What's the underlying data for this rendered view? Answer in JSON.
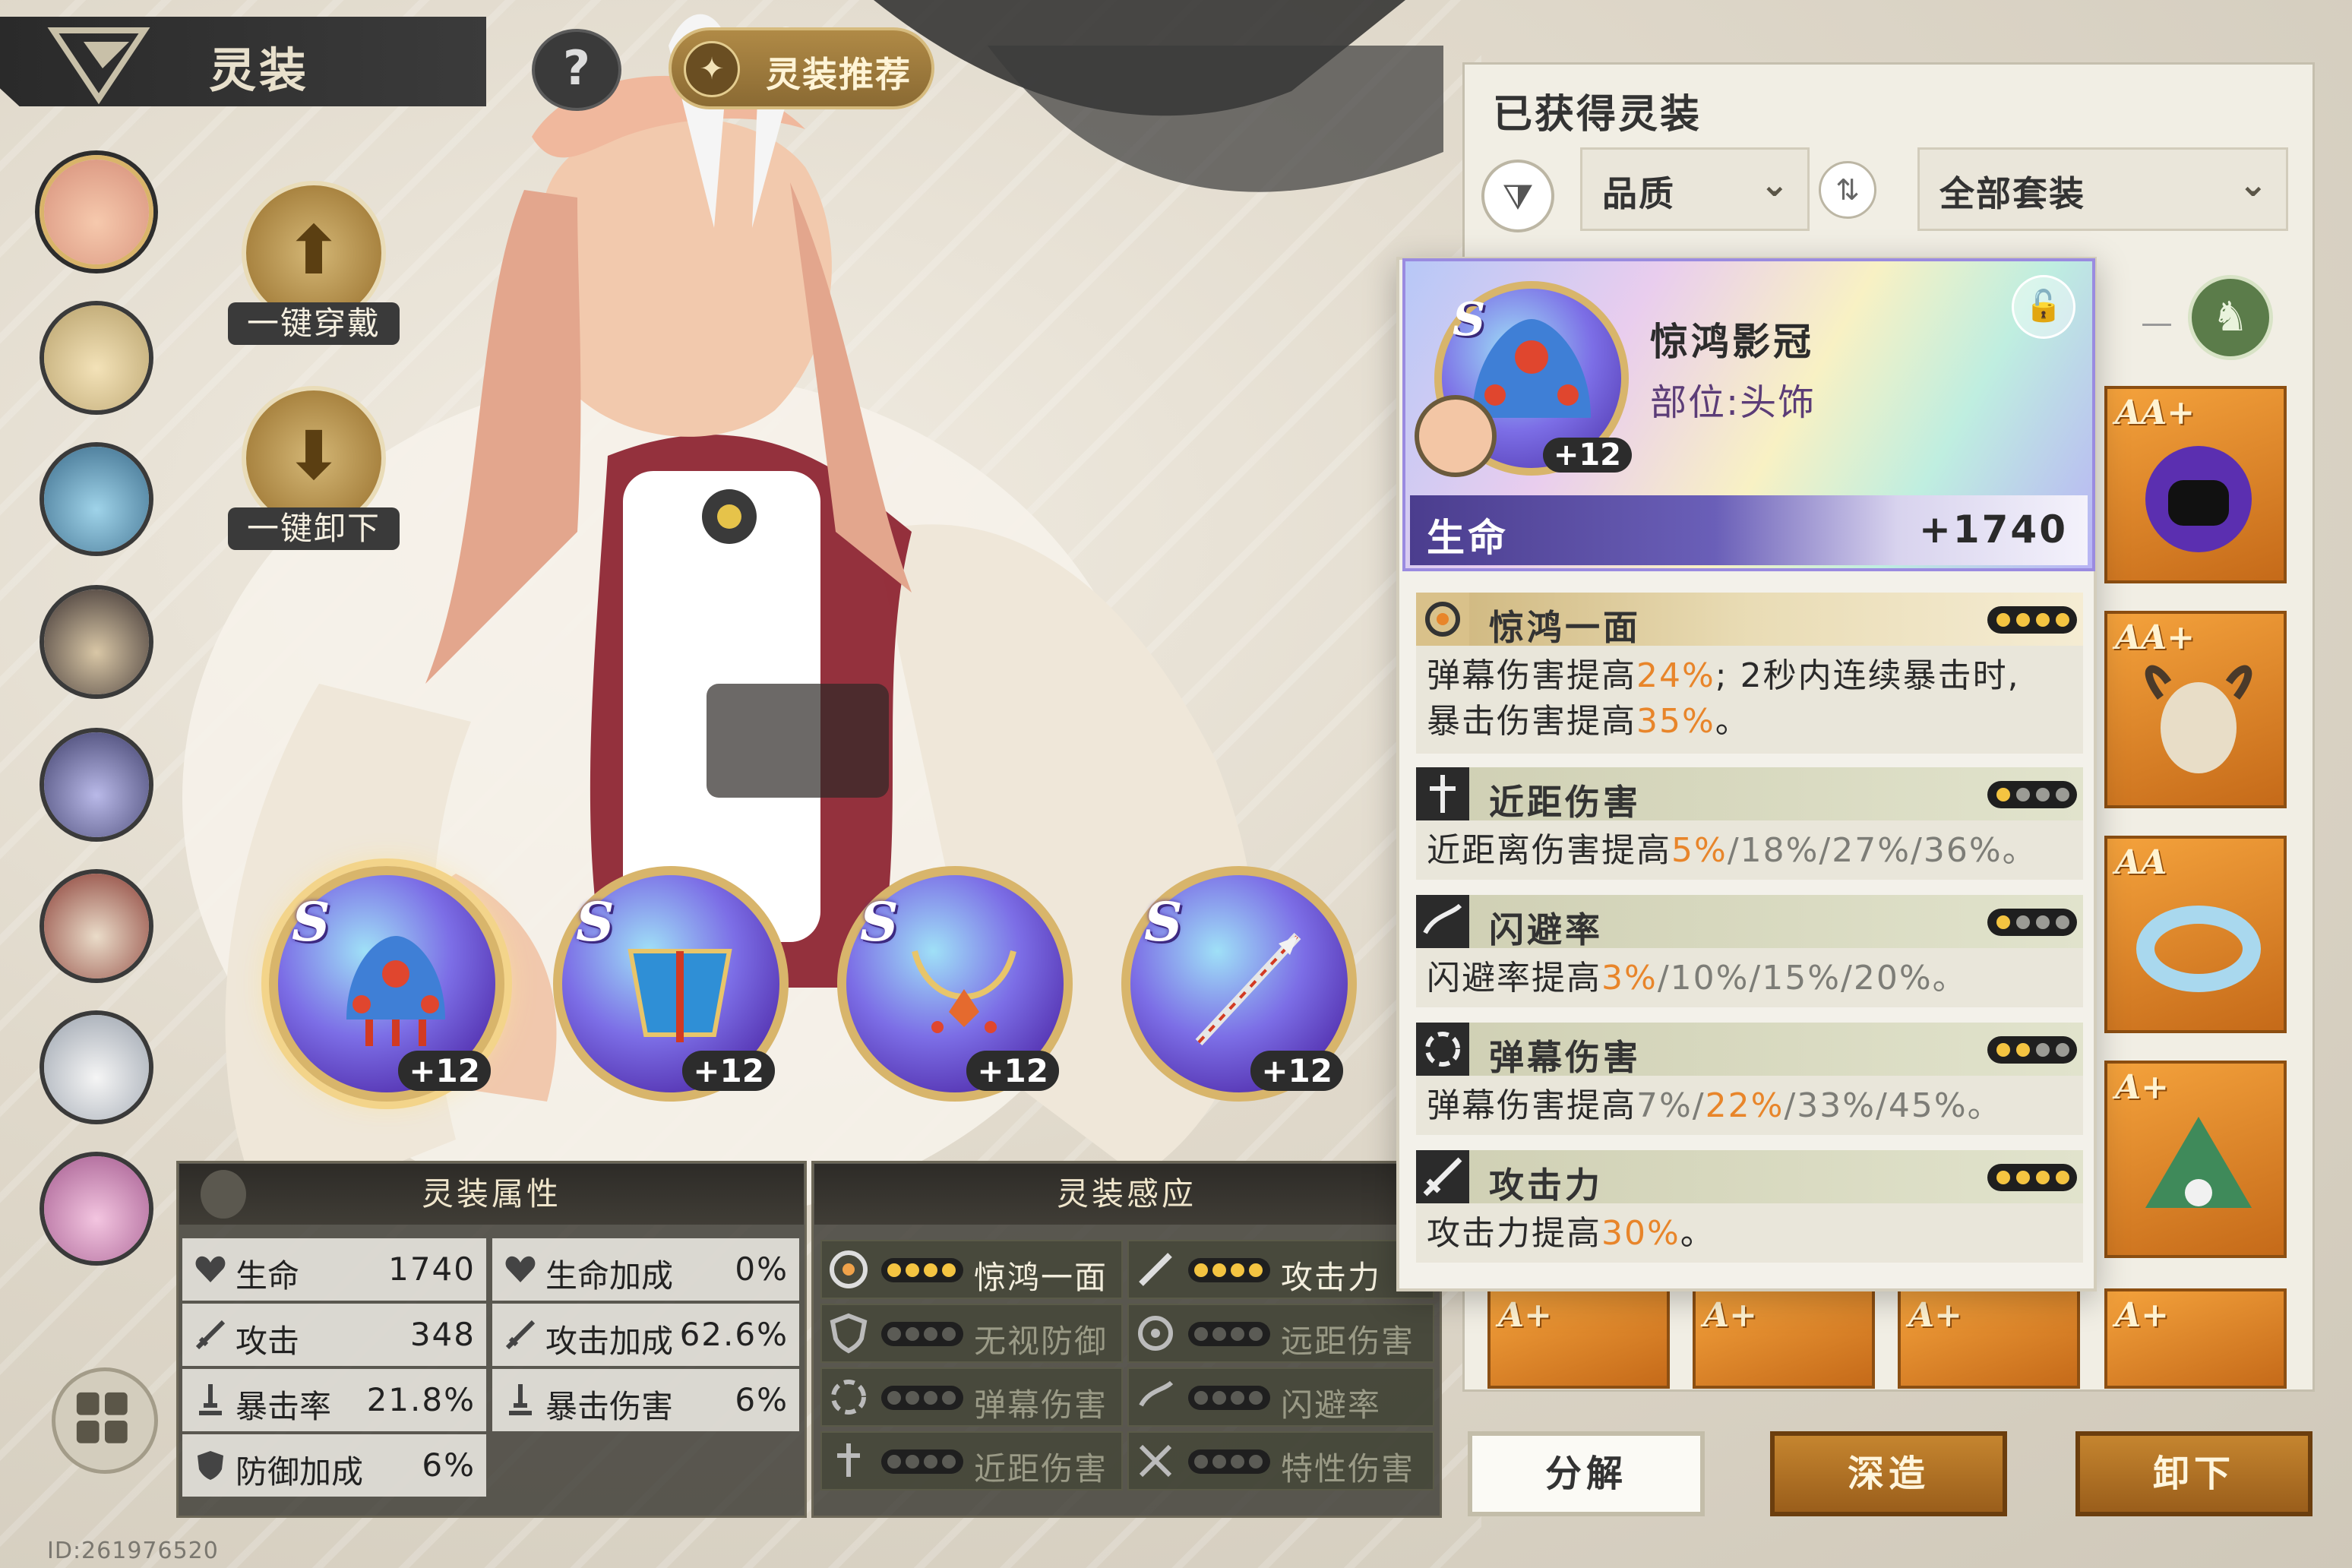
{
  "header": {
    "title": "灵装",
    "recommend_label": "灵装推荐"
  },
  "actions": {
    "equip_all": "一键穿戴",
    "unequip_all": "一键卸下"
  },
  "equipped_slots": [
    {
      "grade": "S",
      "level": "+12"
    },
    {
      "grade": "S",
      "level": "+12"
    },
    {
      "grade": "S",
      "level": "+12"
    },
    {
      "grade": "S",
      "level": "+12"
    }
  ],
  "attributes_panel": {
    "title": "灵装属性",
    "rows": [
      {
        "label": "生命",
        "value": "1740",
        "label2": "生命加成",
        "value2": "0%"
      },
      {
        "label": "攻击",
        "value": "348",
        "label2": "攻击加成",
        "value2": "62.6%"
      },
      {
        "label": "暴击率",
        "value": "21.8%",
        "label2": "暴击伤害",
        "value2": "6%"
      },
      {
        "label": "防御加成",
        "value": "6%"
      }
    ]
  },
  "resonance_panel": {
    "title": "灵装感应",
    "items": [
      {
        "name": "惊鸿一面",
        "active": 4
      },
      {
        "name": "攻击力",
        "active": 4
      },
      {
        "name": "无视防御",
        "active": 0
      },
      {
        "name": "远距伤害",
        "active": 0
      },
      {
        "name": "弹幕伤害",
        "active": 0
      },
      {
        "name": "闪避率",
        "active": 0
      },
      {
        "name": "近距伤害",
        "active": 0
      },
      {
        "name": "特性伤害",
        "active": 0
      }
    ]
  },
  "user_id": "ID:261976520",
  "inventory": {
    "title": "已获得灵装",
    "quality_filter": "品质",
    "set_filter": "全部套装",
    "items_right": [
      {
        "grade": "AA+"
      },
      {
        "grade": "AA+"
      },
      {
        "grade": "AA"
      },
      {
        "grade": "A+"
      }
    ],
    "items_bottom": [
      {
        "grade": "A+"
      },
      {
        "grade": "A+"
      },
      {
        "grade": "A+"
      },
      {
        "grade": "A+"
      }
    ]
  },
  "detail": {
    "grade": "S",
    "level": "+12",
    "name": "惊鸿影冠",
    "part": "部位:头饰",
    "stat_label": "生命",
    "stat_value": "+1740",
    "effects": [
      {
        "name": "惊鸿一面",
        "dots_on": 4,
        "text_parts": [
          "弹幕伤害提高",
          "24%",
          "; 2秒内连续暴击时,",
          "暴击伤害提高",
          "35%",
          "。"
        ]
      },
      {
        "name": "近距伤害",
        "dots_on": 1,
        "text_parts": [
          "近距离伤害提高",
          "5%",
          "/18%/27%/36%。"
        ]
      },
      {
        "name": "闪避率",
        "dots_on": 1,
        "text_parts": [
          "闪避率提高",
          "3%",
          "/10%/15%/20%。"
        ]
      },
      {
        "name": "弹幕伤害",
        "dots_on": 2,
        "text_parts": [
          "弹幕伤害提高",
          "7%/",
          "22%",
          "/33%/45%。"
        ]
      },
      {
        "name": "攻击力",
        "dots_on": 4,
        "text_parts": [
          "攻击力提高",
          "30%",
          "。"
        ]
      }
    ]
  },
  "buttons": {
    "dismantle": "分解",
    "refine": "深造",
    "unequip": "卸下"
  },
  "colors": {
    "accent_gold": "#d8b56b",
    "highlight_orange": "#e8852a",
    "dot_on": "#f4c441"
  }
}
